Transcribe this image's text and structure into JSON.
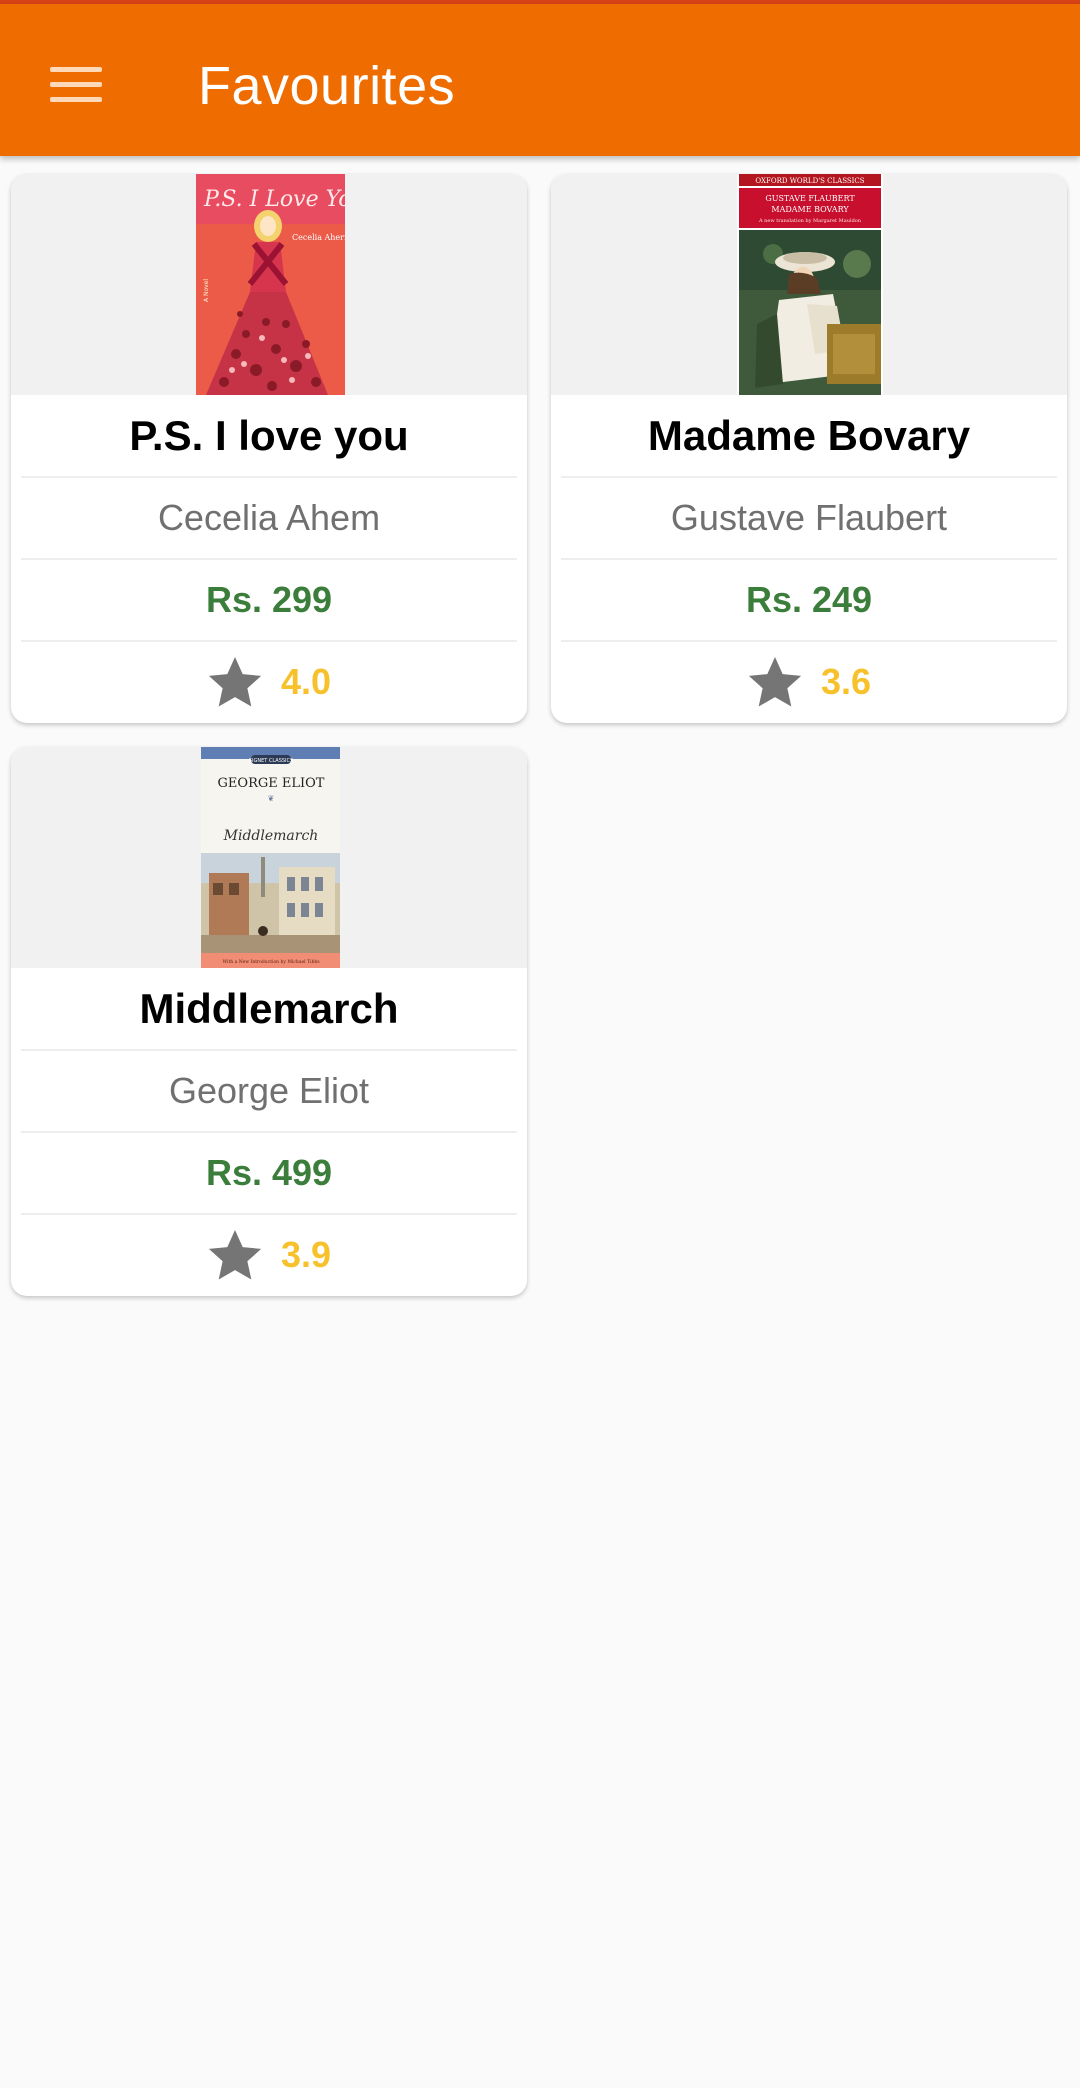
{
  "app_bar": {
    "title": "Favourites",
    "menu_icon": "menu-icon",
    "color": "#ef6c00"
  },
  "books": [
    {
      "title": "P.S. I love you",
      "author": "Cecelia Ahem",
      "price": "Rs. 299",
      "rating": "4.0",
      "cover": {
        "title_text": "P.S. I Love You",
        "author_text": "Cecelia Ahern",
        "tag_text": "A Novel"
      }
    },
    {
      "title": "Madame Bovary",
      "author": "Gustave Flaubert",
      "price": "Rs. 249",
      "rating": "3.6",
      "cover": {
        "series_text": "OXFORD WORLD'S CLASSICS",
        "author_text": "GUSTAVE FLAUBERT",
        "title_text": "MADAME BOVARY",
        "subtitle_text": "A new translation by Margaret Mauldon"
      }
    },
    {
      "title": "Middlemarch",
      "author": "George Eliot",
      "price": "Rs. 499",
      "rating": "3.9",
      "cover": {
        "publisher_text": "SIGNET CLASSICS",
        "author_text": "GEORGE ELIOT",
        "title_text": "Middlemarch",
        "intro_text": "With a New Introduction by Michael Tibbs"
      }
    }
  ],
  "colors": {
    "price": "#3b7d3b",
    "rating": "#f7c12c",
    "star": "#757575"
  }
}
